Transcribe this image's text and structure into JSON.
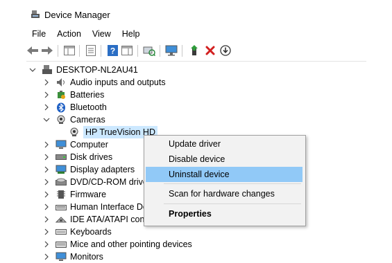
{
  "window": {
    "title": "Device Manager"
  },
  "menu": [
    "File",
    "Action",
    "View",
    "Help"
  ],
  "toolbar": {
    "buttons": [
      "back-icon",
      "forward-icon",
      "properties-pane-icon",
      "list-icon",
      "help-icon",
      "view-icon",
      "scan-icon",
      "monitor-icon",
      "enable-device-icon",
      "uninstall-icon",
      "update-driver-icon"
    ]
  },
  "tree": {
    "root": "DESKTOP-NL2AU41",
    "items": [
      {
        "label": "Audio inputs and outputs",
        "icon": "speaker-icon",
        "state": "collapsed"
      },
      {
        "label": "Batteries",
        "icon": "battery-icon",
        "state": "collapsed"
      },
      {
        "label": "Bluetooth",
        "icon": "bluetooth-icon",
        "state": "collapsed"
      },
      {
        "label": "Cameras",
        "icon": "camera-icon",
        "state": "expanded"
      },
      {
        "label": "HP TrueVision HD",
        "icon": "webcam-icon",
        "state": "child-selected"
      },
      {
        "label": "Computer",
        "icon": "computer-icon",
        "state": "collapsed"
      },
      {
        "label": "Disk drives",
        "icon": "disk-drive-icon",
        "state": "collapsed"
      },
      {
        "label": "Display adapters",
        "icon": "display-adapter-icon",
        "state": "collapsed"
      },
      {
        "label": "DVD/CD-ROM drives",
        "icon": "dvd-icon",
        "state": "collapsed"
      },
      {
        "label": "Firmware",
        "icon": "firmware-icon",
        "state": "collapsed"
      },
      {
        "label": "Human Interface Devices",
        "icon": "hid-icon",
        "state": "collapsed"
      },
      {
        "label": "IDE ATA/ATAPI controllers",
        "icon": "ide-controller-icon",
        "state": "collapsed"
      },
      {
        "label": "Keyboards",
        "icon": "keyboard-icon",
        "state": "collapsed"
      },
      {
        "label": "Mice and other pointing devices",
        "icon": "mouse-icon",
        "state": "collapsed"
      },
      {
        "label": "Monitors",
        "icon": "monitor-icon",
        "state": "collapsed"
      }
    ]
  },
  "context_menu": {
    "items": [
      {
        "label": "Update driver"
      },
      {
        "label": "Disable device"
      },
      {
        "label": "Uninstall device",
        "highlighted": true
      },
      {
        "label": "Scan for hardware changes"
      },
      {
        "label": "Properties",
        "bold": true
      }
    ]
  },
  "colors": {
    "selection": "#cce8ff",
    "menu_highlight": "#91c9f7",
    "menu_bg": "#f2f2f2"
  }
}
